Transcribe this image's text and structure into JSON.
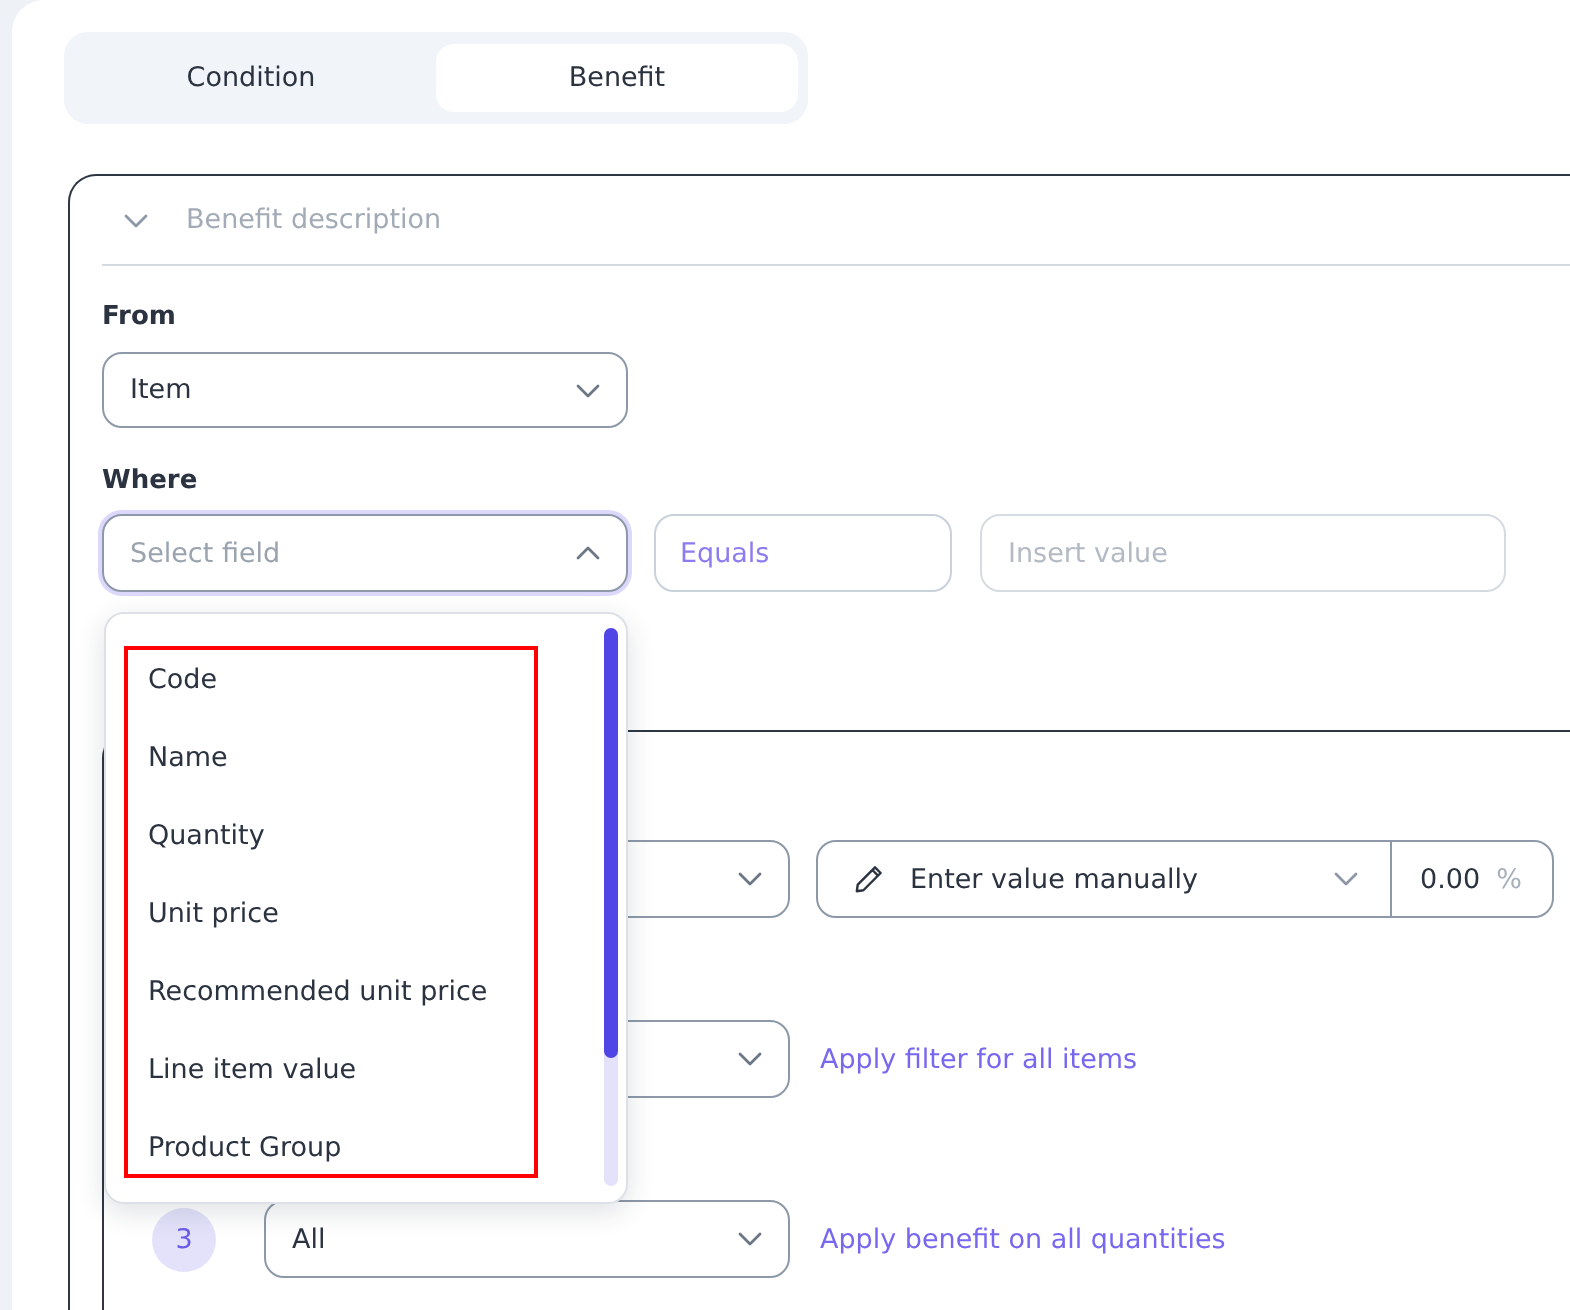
{
  "tabs": [
    {
      "label": "Condition",
      "selected": false
    },
    {
      "label": "Benefit",
      "selected": true
    }
  ],
  "section": {
    "title": "Benefit description"
  },
  "from": {
    "label": "From",
    "value": "Item"
  },
  "where": {
    "label": "Where",
    "field": {
      "placeholder": "Select field",
      "open": true
    },
    "operator": {
      "value": "Equals"
    },
    "value": {
      "placeholder": "Insert value"
    }
  },
  "field_menu": {
    "highlighted": true,
    "items": [
      {
        "label": "Code",
        "selected": false
      },
      {
        "label": "Name",
        "selected": false
      },
      {
        "label": "Quantity",
        "selected": false
      },
      {
        "label": "Unit price",
        "selected": false
      },
      {
        "label": "Recommended unit price",
        "selected": false
      },
      {
        "label": "Line item value",
        "selected": false
      },
      {
        "label": "Product Group",
        "selected": false
      }
    ]
  },
  "rules": [
    {
      "kind": "value",
      "mode": "Enter value manually",
      "amount": "0.00",
      "unit": "%"
    },
    {
      "kind": "filter",
      "link": "Apply filter for all items"
    },
    {
      "kind": "quantity",
      "step": "3",
      "value": "All",
      "link": "Apply benefit on all quantities"
    }
  ]
}
